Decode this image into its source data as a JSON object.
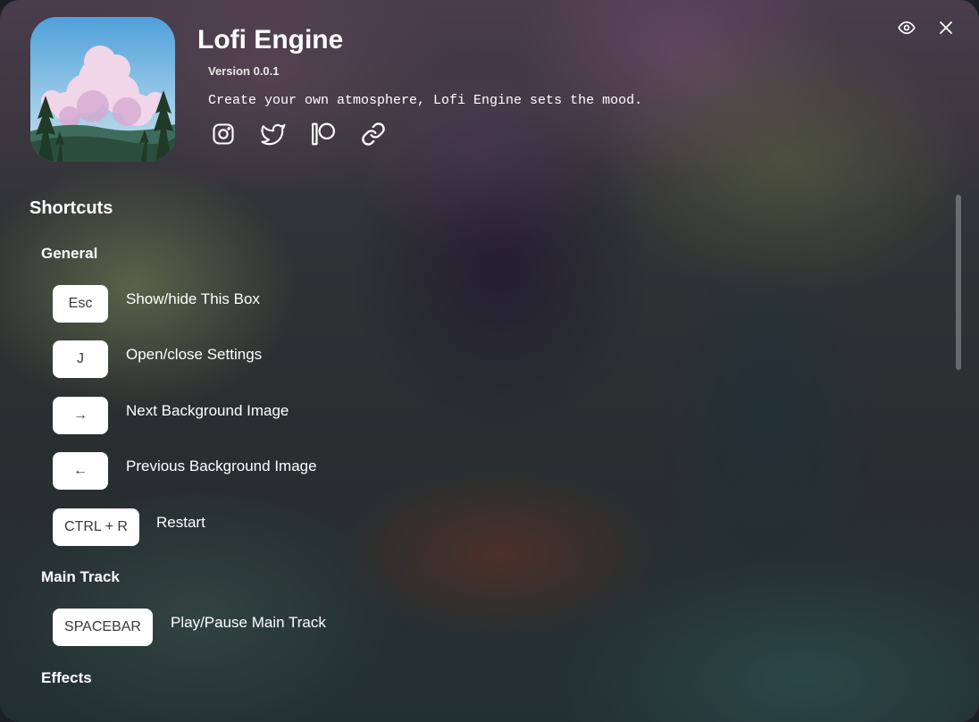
{
  "header": {
    "title": "Lofi Engine",
    "version": "Version 0.0.1",
    "tagline": "Create your own atmosphere, Lofi Engine sets the mood."
  },
  "socials": [
    {
      "name": "instagram-icon"
    },
    {
      "name": "twitter-icon"
    },
    {
      "name": "patreon-icon"
    },
    {
      "name": "link-icon"
    }
  ],
  "top_buttons": {
    "visibility_icon": "eye-icon",
    "close_icon": "close-icon"
  },
  "shortcuts": {
    "title": "Shortcuts",
    "groups": [
      {
        "title": "General",
        "items": [
          {
            "key": "Esc",
            "label": "Show/hide This Box"
          },
          {
            "key": "J",
            "label": "Open/close Settings"
          },
          {
            "key": "→",
            "label": "Next Background Image"
          },
          {
            "key": "←",
            "label": "Previous Background Image"
          },
          {
            "key": "CTRL + R",
            "label": "Restart"
          }
        ]
      },
      {
        "title": "Main Track",
        "items": [
          {
            "key": "SPACEBAR",
            "label": "Play/Pause Main Track"
          }
        ]
      },
      {
        "title": "Effects",
        "items": []
      }
    ]
  },
  "colors": {
    "key_background": "#ffffff",
    "key_text": "#3a3a3a",
    "text": "#ffffff"
  }
}
